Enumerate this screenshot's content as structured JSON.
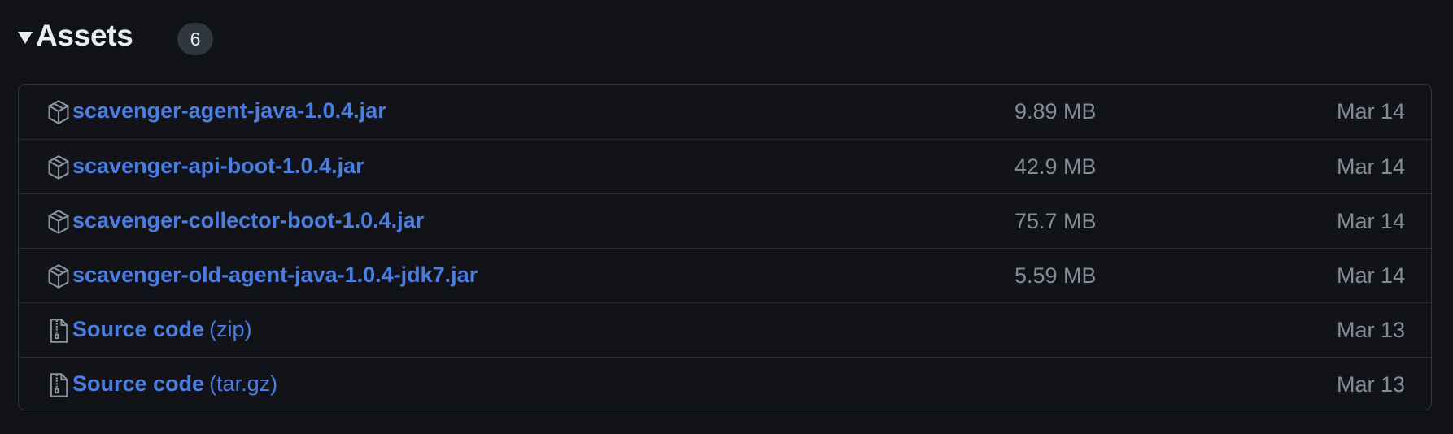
{
  "assets": {
    "title": "Assets",
    "count": "6",
    "items": [
      {
        "name": "scavenger-agent-java-1.0.4.jar",
        "suffix": "",
        "size": "9.89 MB",
        "date": "Mar 14",
        "icon": "package-icon"
      },
      {
        "name": "scavenger-api-boot-1.0.4.jar",
        "suffix": "",
        "size": "42.9 MB",
        "date": "Mar 14",
        "icon": "package-icon"
      },
      {
        "name": "scavenger-collector-boot-1.0.4.jar",
        "suffix": "",
        "size": "75.7 MB",
        "date": "Mar 14",
        "icon": "package-icon"
      },
      {
        "name": "scavenger-old-agent-java-1.0.4-jdk7.jar",
        "suffix": "",
        "size": "5.59 MB",
        "date": "Mar 14",
        "icon": "package-icon"
      },
      {
        "name": "Source code",
        "suffix": "(zip)",
        "size": "",
        "date": "Mar 13",
        "icon": "file-zip-icon"
      },
      {
        "name": "Source code",
        "suffix": "(tar.gz)",
        "size": "",
        "date": "Mar 13",
        "icon": "file-zip-icon"
      }
    ]
  },
  "colors": {
    "background": "#111217",
    "link": "#4a7ee3",
    "muted": "#848d97",
    "border": "#30363d",
    "heading": "#e6edf3"
  }
}
